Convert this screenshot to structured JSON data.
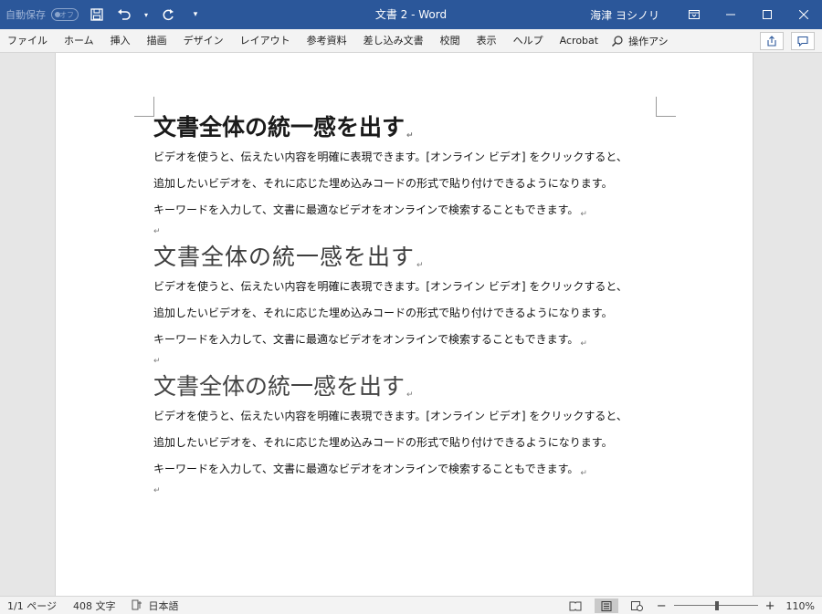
{
  "titlebar": {
    "autosave_label": "自動保存",
    "autosave_toggle": "オフ",
    "doc_title": "文書 2 - Word",
    "user_name": "海津 ヨシノリ"
  },
  "ribbon": {
    "tabs": [
      "ファイル",
      "ホーム",
      "挿入",
      "描画",
      "デザイン",
      "レイアウト",
      "参考資料",
      "差し込み文書",
      "校閲",
      "表示",
      "ヘルプ",
      "Acrobat"
    ],
    "tell_me": "操作アシ"
  },
  "document": {
    "sections": [
      {
        "heading": "文書全体の統一感を出す",
        "lines": [
          "ビデオを使うと、伝えたい内容を明確に表現できます。[オンライン ビデオ] をクリックすると、",
          "追加したいビデオを、それに応じた埋め込みコードの形式で貼り付けできるようになります。",
          "キーワードを入力して、文書に最適なビデオをオンラインで検索することもできます。"
        ]
      },
      {
        "heading": "文書全体の統一感を出す",
        "lines": [
          "ビデオを使うと、伝えたい内容を明確に表現できます。[オンライン ビデオ] をクリックすると、",
          "追加したいビデオを、それに応じた埋め込みコードの形式で貼り付けできるようになります。",
          "キーワードを入力して、文書に最適なビデオをオンラインで検索することもできます。"
        ]
      },
      {
        "heading": "文書全体の統一感を出す",
        "lines": [
          "ビデオを使うと、伝えたい内容を明確に表現できます。[オンライン ビデオ] をクリックすると、",
          "追加したいビデオを、それに応じた埋め込みコードの形式で貼り付けできるようになります。",
          "キーワードを入力して、文書に最適なビデオをオンラインで検索することもできます。"
        ]
      }
    ],
    "paragraph_mark": "↵"
  },
  "statusbar": {
    "page": "1/1 ページ",
    "words": "408 文字",
    "language": "日本語",
    "zoom": "110%",
    "zoom_level": 1.1
  },
  "colors": {
    "titlebar": "#2b579a",
    "ribbon": "#f3f3f3",
    "workspace": "#e6e6e6"
  }
}
